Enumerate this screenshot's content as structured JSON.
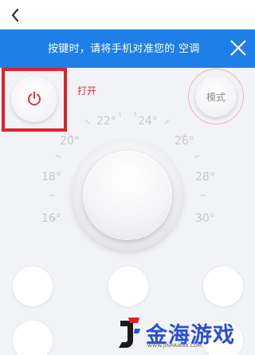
{
  "banner": {
    "text": "按键时，请将手机对准您的 空调"
  },
  "power": {
    "label": "打开"
  },
  "mode": {
    "label": "模式"
  },
  "dial": {
    "temps": [
      "16°",
      "18°",
      "20°",
      "22°",
      "24°",
      "26°",
      "28°",
      "30°"
    ]
  },
  "watermark": {
    "name": "金海游戏",
    "url": "WWW.JINHAI888.COM"
  },
  "colors": {
    "banner": "#1e7fe8",
    "highlight": "#e0212b",
    "power_icon": "#e0343e",
    "brand": "#2a4fd6"
  },
  "icons": {
    "back": "chevron-left-icon",
    "close": "close-icon",
    "power": "power-icon",
    "logo": "logo-icon"
  }
}
